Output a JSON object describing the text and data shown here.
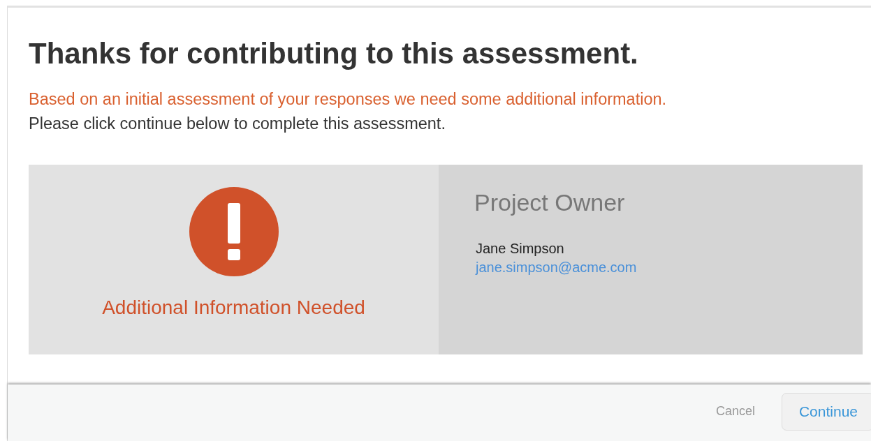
{
  "dialog": {
    "title": "Thanks for contributing to this assessment.",
    "notice": "Based on an initial assessment of your responses we need some additional information.",
    "instruction": "Please click continue below to complete this assessment.",
    "status": {
      "kind": "warning",
      "label": "Additional Information Needed"
    },
    "contact": {
      "heading": "Project Owner",
      "name": "Jane Simpson",
      "email": "jane.simpson@acme.com"
    }
  },
  "buttons": [
    {
      "label": "Cancel",
      "kind": "link"
    },
    {
      "label": "Continue",
      "kind": "secondary"
    }
  ]
}
